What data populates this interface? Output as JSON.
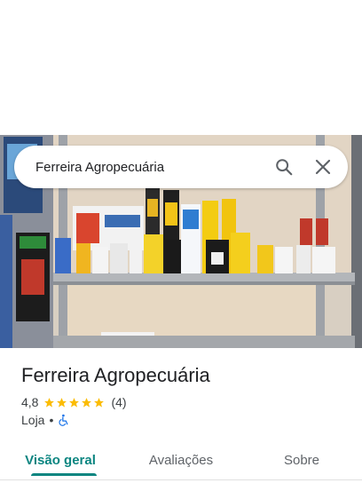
{
  "search": {
    "query": "Ferreira Agropecuária"
  },
  "photo": {
    "description_icon": "storefront-photo"
  },
  "place": {
    "name": "Ferreira Agropecuária",
    "rating": "4,8",
    "stars": 5,
    "review_count": "(4)",
    "category": "Loja",
    "separator": "•",
    "accessibility_icon": "wheelchair-icon"
  },
  "tabs": [
    {
      "label": "Visão geral",
      "active": true
    },
    {
      "label": "Avaliações",
      "active": false
    },
    {
      "label": "Sobre",
      "active": false
    }
  ],
  "colors": {
    "accent": "#0b8580",
    "star": "#fbbc04",
    "accessibility": "#1a73e8"
  }
}
